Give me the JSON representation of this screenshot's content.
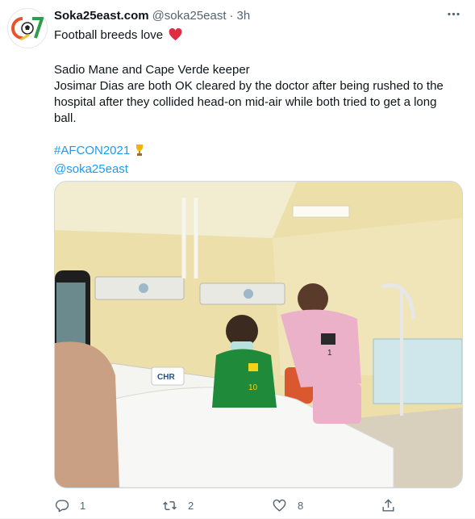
{
  "author": {
    "name": "Soka25east.com",
    "handle": "@soka25east",
    "separator": "·",
    "time": "3h"
  },
  "tweet": {
    "line1": "Football breeds love",
    "line2": "Sadio Mane and Cape Verde keeper",
    "line3": "Josimar Dias are both OK cleared by the doctor after being rushed to the hospital after they collided head-on mid-air while both tried to get a long ball.",
    "hashtag": "#AFCON2021",
    "mention": "@soka25east"
  },
  "media": {
    "bed_logo": "CHR",
    "jersey_number_green": "10",
    "jersey_number_pink": "1"
  },
  "actions": {
    "reply_count": "1",
    "retweet_count": "2",
    "like_count": "8"
  },
  "colors": {
    "link": "#1d9bf0",
    "heart": "#f91880",
    "muted": "#536471"
  },
  "icons": [
    "more-icon",
    "heart-emoji-icon",
    "trophy-emoji-icon",
    "reply-icon",
    "retweet-icon",
    "like-icon",
    "share-icon"
  ]
}
